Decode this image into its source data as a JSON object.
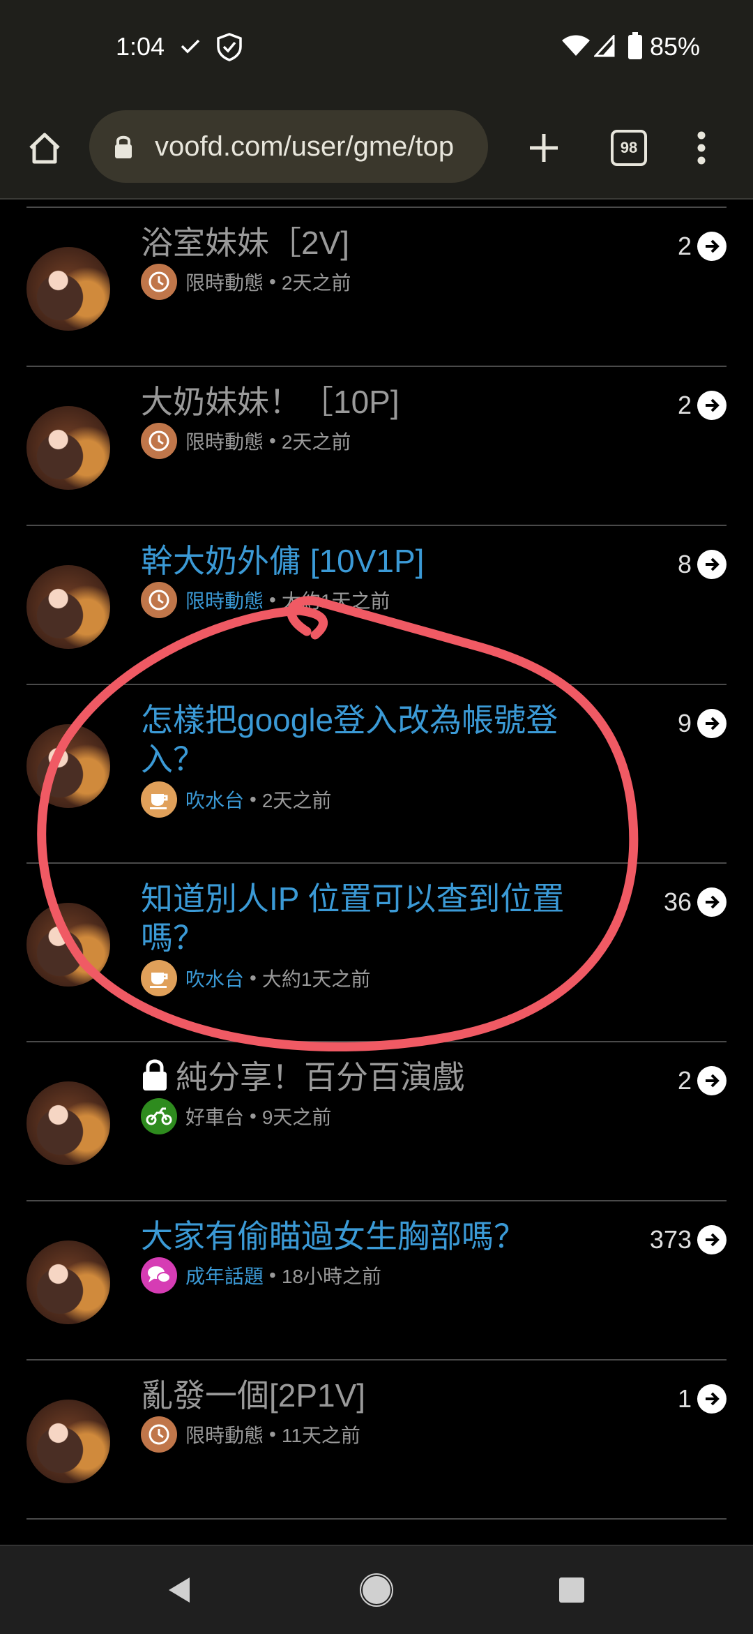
{
  "status_bar": {
    "time": "1:04",
    "battery": "85%",
    "icons": [
      "check-icon",
      "shield-icon",
      "wifi-icon",
      "signal-icon",
      "battery-icon"
    ]
  },
  "browser": {
    "url": "voofd.com/user/gme/top",
    "tab_count": "98"
  },
  "topics": [
    {
      "title": "浴室妹妹［2V]",
      "state": "read",
      "category": "限時動態",
      "category_icon": "clock-icon",
      "category_color": "#c0764a",
      "time": "2天之前",
      "count": "2",
      "locked": false
    },
    {
      "title": "大奶妹妹！［10P]",
      "state": "read",
      "category": "限時動態",
      "category_icon": "clock-icon",
      "category_color": "#c0764a",
      "time": "2天之前",
      "count": "2",
      "locked": false
    },
    {
      "title": "幹大奶外傭 [10V1P]",
      "state": "unread",
      "category": "限時動態",
      "category_icon": "clock-icon",
      "category_color": "#c0764a",
      "time": "大約1天之前",
      "count": "8",
      "locked": false
    },
    {
      "title": "怎樣把google登入改為帳號登入？",
      "state": "unread",
      "category": "吹水台",
      "category_icon": "coffee-icon",
      "category_color": "#e0a05a",
      "time": "2天之前",
      "count": "9",
      "locked": false
    },
    {
      "title": "知道別人IP 位置可以查到位置嗎？",
      "state": "unread",
      "category": "吹水台",
      "category_icon": "coffee-icon",
      "category_color": "#e0a05a",
      "time": "大約1天之前",
      "count": "36",
      "locked": false
    },
    {
      "title": "純分享！百分百演戲",
      "state": "read",
      "category": "好車台",
      "category_icon": "motorcycle-icon",
      "category_color": "#2e8b1e",
      "time": "9天之前",
      "count": "2",
      "locked": true
    },
    {
      "title": "大家有偷瞄過女生胸部嗎？",
      "state": "unread",
      "category": "成年話題",
      "category_icon": "chat-bubbles-icon",
      "category_color": "#d63cb4",
      "time": "18小時之前",
      "count": "373",
      "locked": false
    },
    {
      "title": "亂發一個[2P1V]",
      "state": "read",
      "category": "限時動態",
      "category_icon": "clock-icon",
      "category_color": "#c0764a",
      "time": "11天之前",
      "count": "1",
      "locked": false
    }
  ],
  "separator": "•",
  "colors": {
    "link_blue": "#3b9ad6",
    "annotation_red": "#f05a64"
  }
}
